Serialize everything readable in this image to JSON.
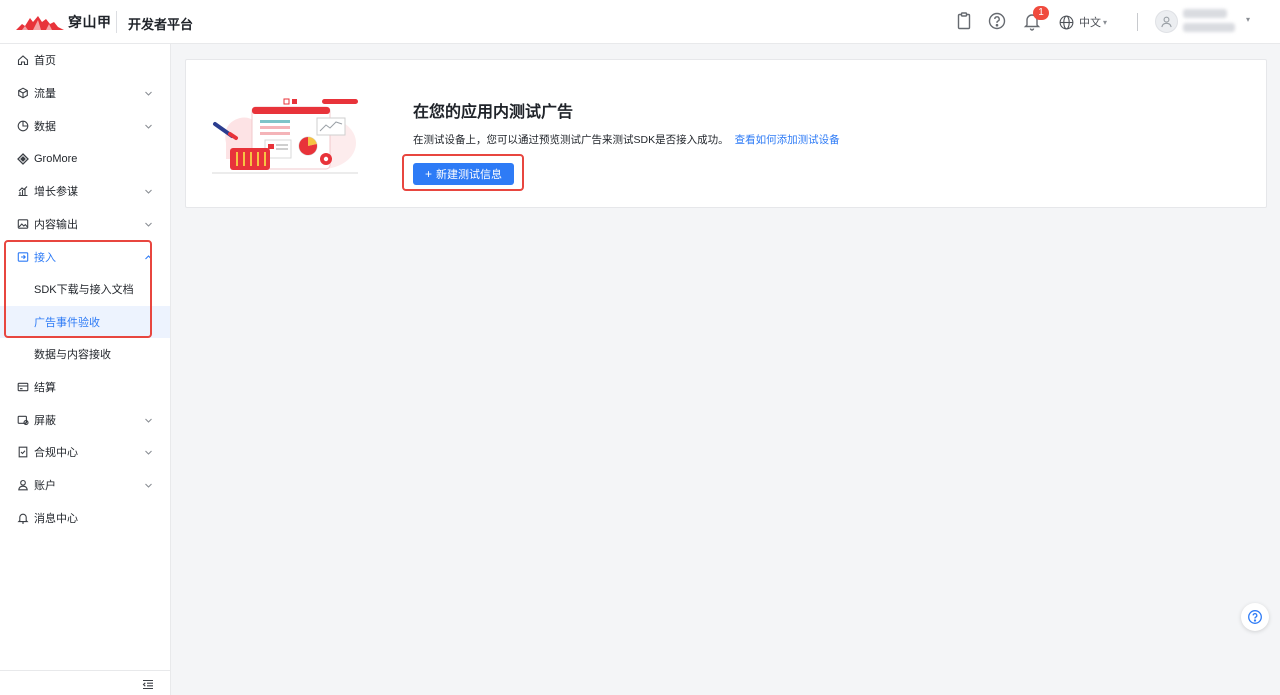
{
  "header": {
    "logo_text": "穿山甲",
    "platform_title": "开发者平台",
    "notification_count": "1",
    "language": "中文"
  },
  "sidebar": {
    "items": [
      {
        "label": "首页"
      },
      {
        "label": "流量"
      },
      {
        "label": "数据"
      },
      {
        "label": "GroMore"
      },
      {
        "label": "增长参谋"
      },
      {
        "label": "内容输出"
      },
      {
        "label": "接入"
      },
      {
        "label": "SDK下载与接入文档"
      },
      {
        "label": "广告事件验收"
      },
      {
        "label": "数据与内容接收"
      },
      {
        "label": "结算"
      },
      {
        "label": "屏蔽"
      },
      {
        "label": "合规中心"
      },
      {
        "label": "账户"
      },
      {
        "label": "消息中心"
      }
    ]
  },
  "main": {
    "title": "在您的应用内测试广告",
    "description": "在测试设备上，您可以通过预览测试广告来测试SDK是否接入成功。",
    "link_text": "查看如何添加测试设备",
    "button_plus": "+",
    "button_label": "新建测试信息"
  },
  "colors": {
    "accent": "#2e7bf6",
    "highlight": "#e8463f",
    "brand_red": "#e8333a"
  }
}
